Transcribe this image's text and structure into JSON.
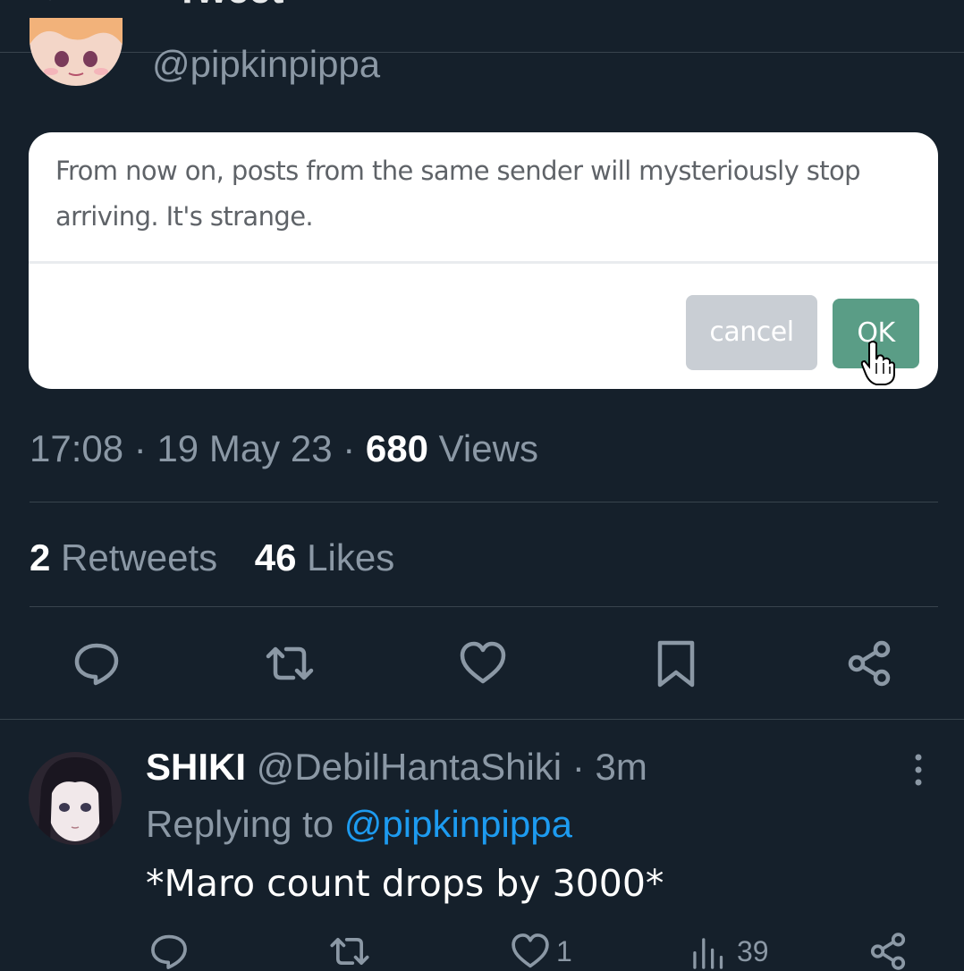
{
  "header": {
    "title": "Tweet"
  },
  "tweet": {
    "handle": "@pipkinpippa",
    "dialog": {
      "message": "From now on, posts from the same sender will mysteriously stop arriving. It's strange.",
      "cancel_label": "cancel",
      "ok_label": "OK"
    },
    "meta": {
      "time": "17:08",
      "date": "19 May 23",
      "views_count": "680",
      "views_label": "Views",
      "separator": "·"
    },
    "stats": {
      "retweets_count": "2",
      "retweets_label": "Retweets",
      "likes_count": "46",
      "likes_label": "Likes"
    }
  },
  "reply": {
    "name": "SHIKI",
    "handle": "@DebilHantaShiki",
    "time": "3m",
    "replying_label": "Replying to",
    "mention": "@pipkinpippa",
    "text": "*Maro count drops by 3000*",
    "like_count": "1",
    "views_count": "39"
  },
  "colors": {
    "background": "#15202b",
    "accent": "#1d9bf0",
    "ok_button": "#5a9d86",
    "cancel_button": "#c9ced4"
  }
}
